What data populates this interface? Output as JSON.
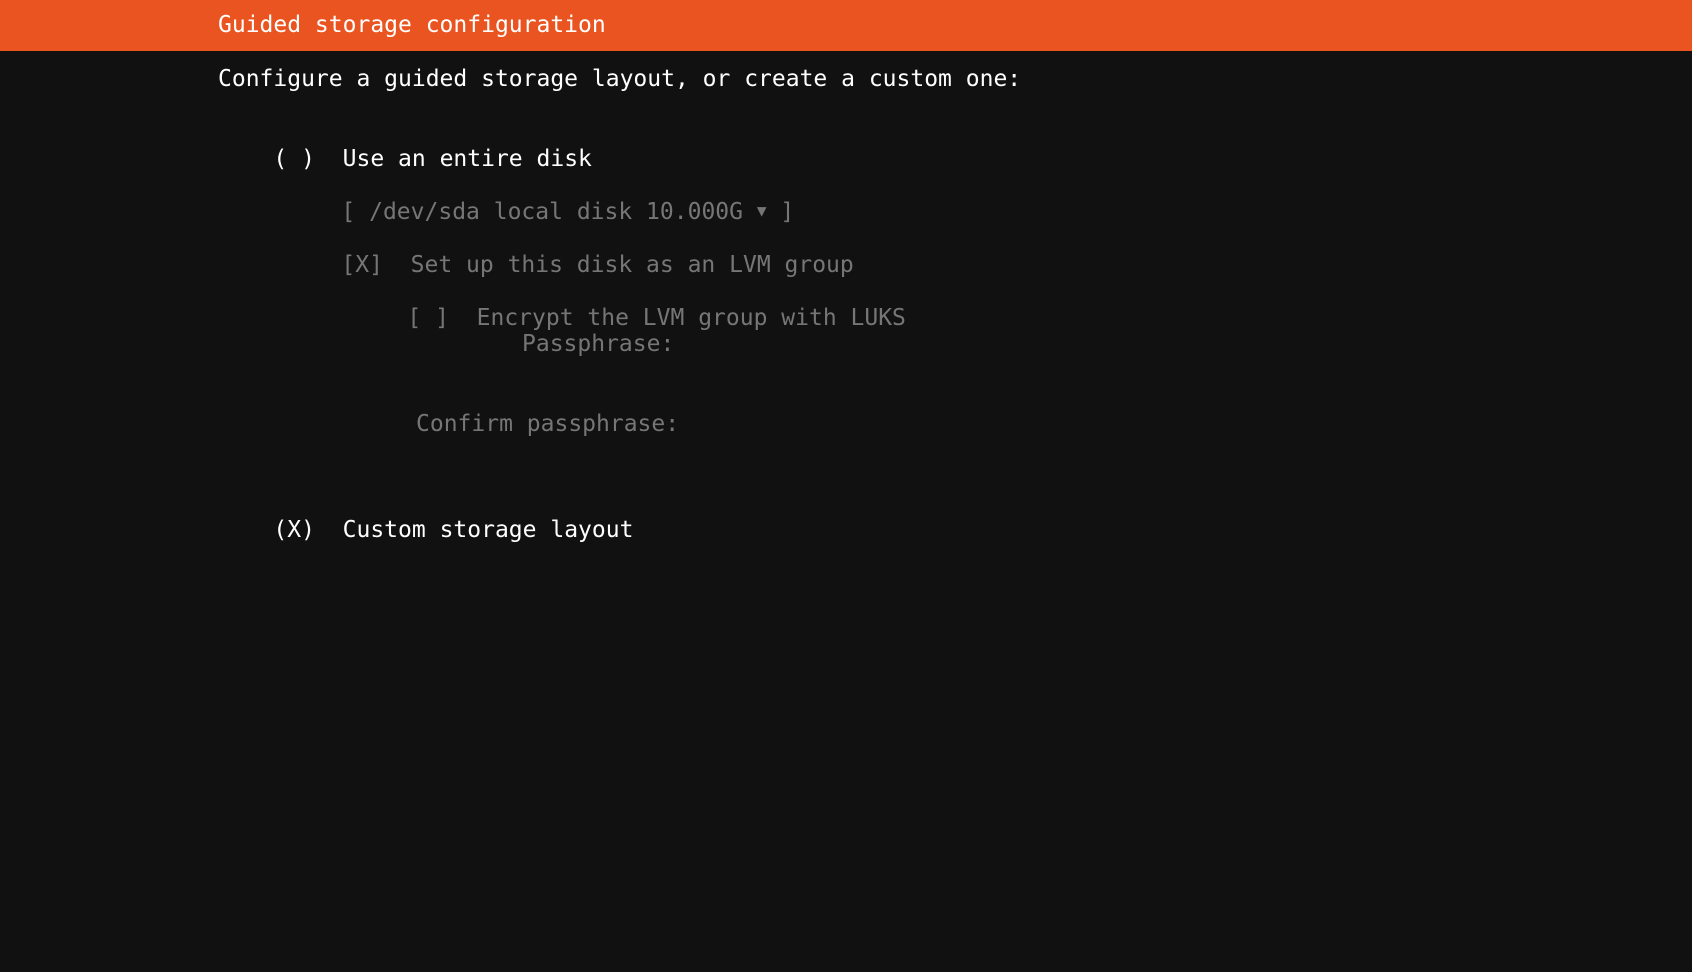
{
  "header": {
    "title": "Guided storage configuration"
  },
  "intro": "Configure a guided storage layout, or create a custom one:",
  "options": {
    "entire_disk": {
      "radio": "( )",
      "label": "Use an entire disk"
    },
    "disk_select": {
      "open_bracket": "[",
      "value": "/dev/sda local disk 10.000G",
      "arrow": "▼",
      "close_bracket": "]"
    },
    "lvm": {
      "checkbox": "[X]",
      "label": "Set up this disk as an LVM group"
    },
    "luks": {
      "checkbox": "[ ]",
      "label": "Encrypt the LVM group with LUKS"
    },
    "passphrase_label": "Passphrase:",
    "confirm_passphrase_label": "Confirm passphrase:",
    "custom": {
      "radio": "(X)",
      "label": "Custom storage layout"
    }
  },
  "colors": {
    "header_bg": "#e95420",
    "bg": "#111111",
    "text": "#ffffff",
    "disabled_text": "#767676"
  }
}
